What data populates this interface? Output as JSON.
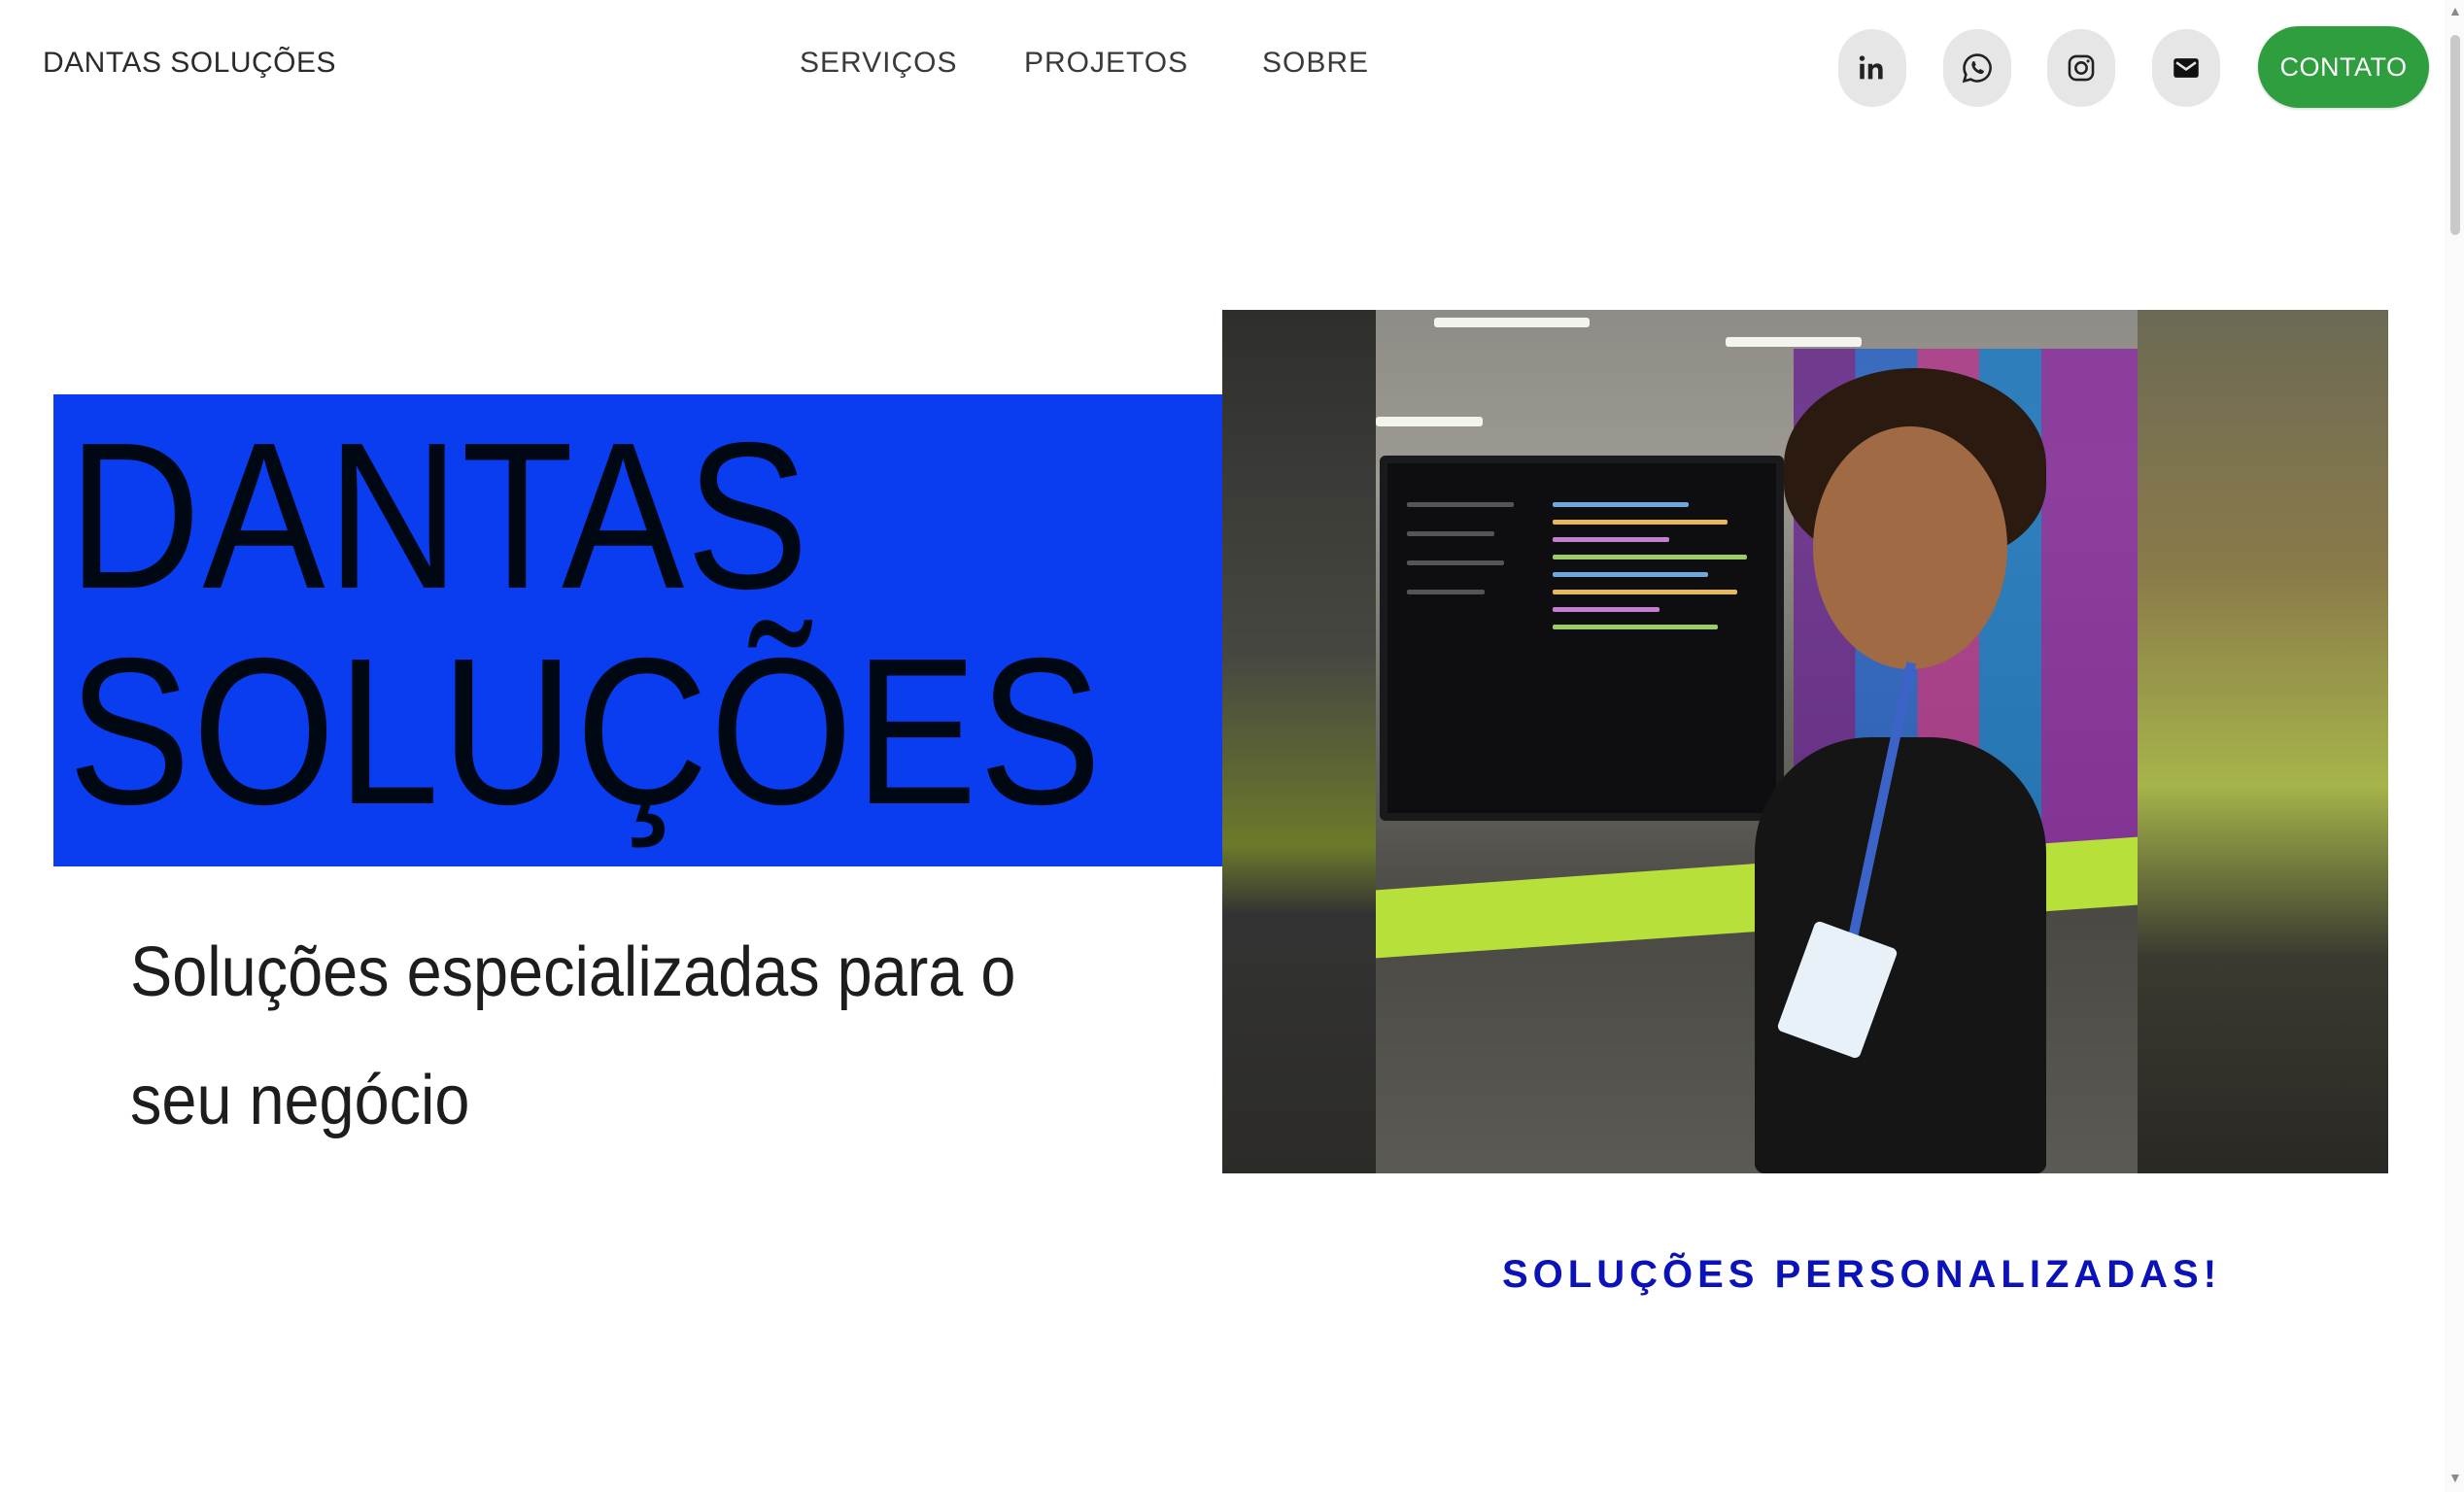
{
  "header": {
    "brand": "DANTAS SOLUÇÕES",
    "nav": [
      {
        "label": "SERVIÇOS"
      },
      {
        "label": "PROJETOS"
      },
      {
        "label": "SOBRE"
      }
    ],
    "social": [
      {
        "icon": "linkedin-icon"
      },
      {
        "icon": "whatsapp-icon"
      },
      {
        "icon": "instagram-icon"
      },
      {
        "icon": "mail-icon"
      }
    ],
    "contact_label": "CONTATO"
  },
  "hero": {
    "title_line1": "DANTAS",
    "title_line2": "SOLUÇÕES",
    "subtitle": "Soluções especializadas para o seu negócio",
    "tagline": "SOLUÇÕES PERSONALIZADAS!"
  },
  "colors": {
    "hero_block": "#0a3df0",
    "contact_button": "#2e9e3e",
    "tagline": "#0b12b8"
  }
}
